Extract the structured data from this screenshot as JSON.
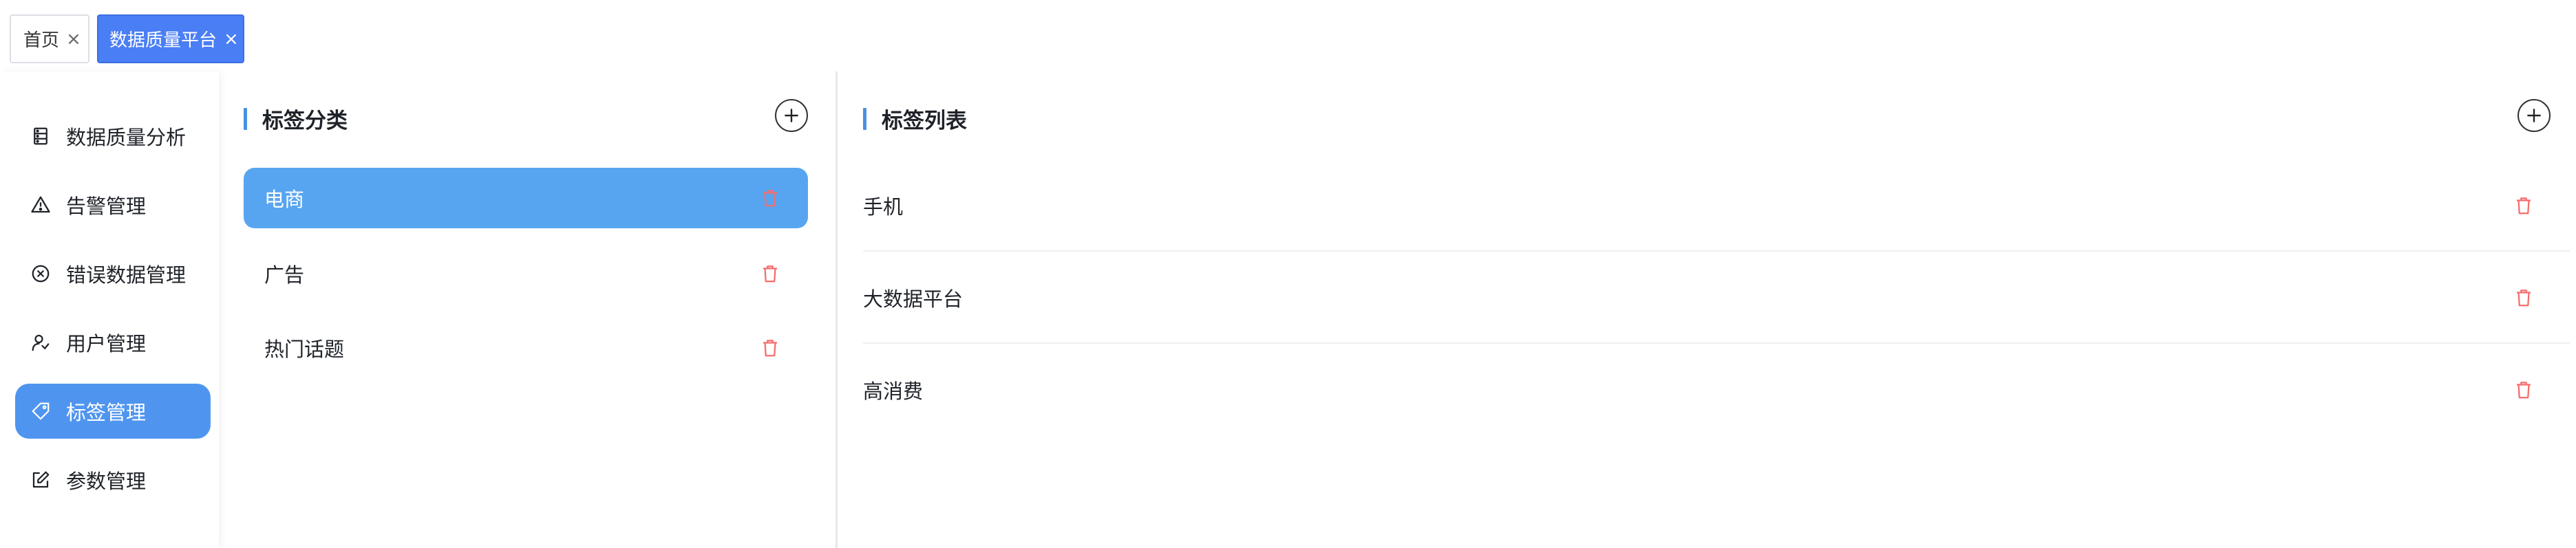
{
  "tabs": [
    {
      "label": "首页",
      "close": "×",
      "active": false
    },
    {
      "label": "数据质量平台",
      "close": "×",
      "active": true
    }
  ],
  "sidebar": {
    "items": [
      {
        "label": "数据质量分析",
        "icon": "database-icon",
        "active": false
      },
      {
        "label": "告警管理",
        "icon": "warning-icon",
        "active": false
      },
      {
        "label": "错误数据管理",
        "icon": "error-circle-icon",
        "active": false
      },
      {
        "label": "用户管理",
        "icon": "user-manage-icon",
        "active": false
      },
      {
        "label": "标签管理",
        "icon": "tag-icon",
        "active": true
      },
      {
        "label": "参数管理",
        "icon": "edit-icon",
        "active": false
      }
    ]
  },
  "categories": {
    "title": "标签分类",
    "add_icon": "plus-icon",
    "items": [
      {
        "label": "电商",
        "active": true
      },
      {
        "label": "广告",
        "active": false
      },
      {
        "label": "热门话题",
        "active": false
      }
    ]
  },
  "tag_list": {
    "title": "标签列表",
    "add_icon": "plus-icon",
    "items": [
      {
        "label": "手机"
      },
      {
        "label": "大数据平台"
      },
      {
        "label": "高消费"
      }
    ]
  },
  "colors": {
    "accent": "#4a7ef5",
    "sidebar_active": "#4f95f0",
    "category_active": "#57a5f0",
    "danger": "#f56c6c",
    "title_bar": "#4a90e2"
  }
}
